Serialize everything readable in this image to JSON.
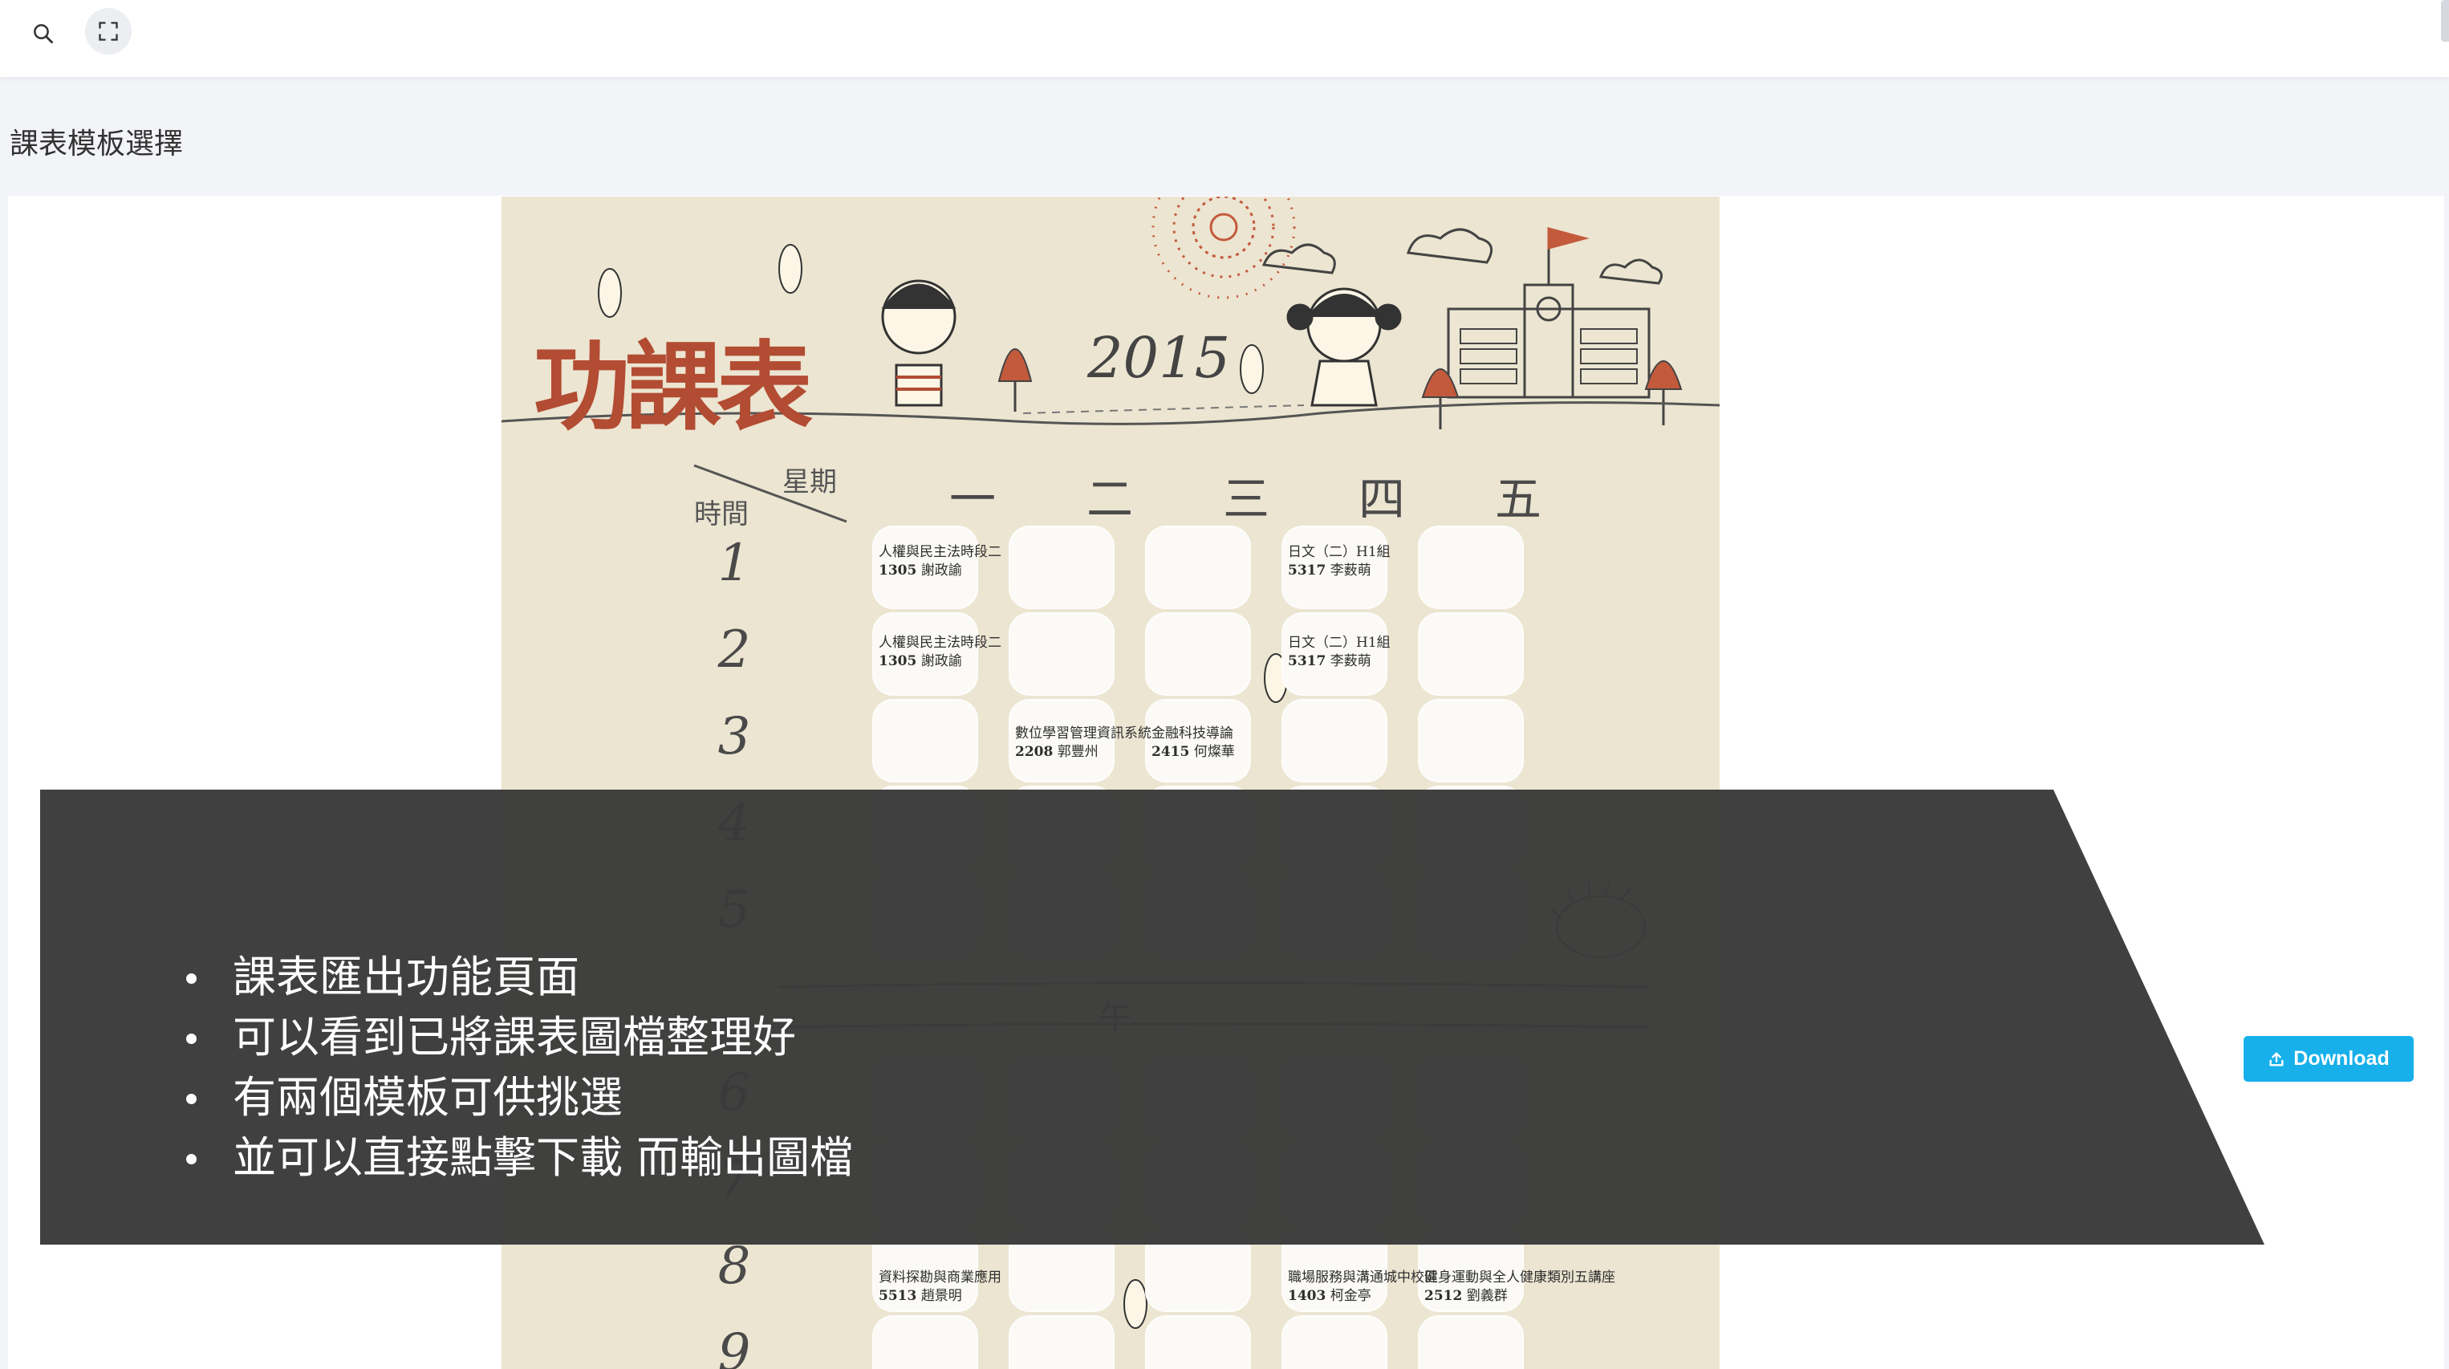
{
  "header": {
    "search_icon": "search-icon",
    "fullscreen_icon": "fullscreen-icon"
  },
  "page": {
    "title": "課表模板選擇"
  },
  "template": {
    "poster_title": "功課表",
    "year": "2015",
    "corner_week": "星期",
    "corner_time": "時間",
    "days": [
      "一",
      "二",
      "三",
      "四",
      "五"
    ],
    "periods": [
      "1",
      "2",
      "3",
      "4",
      "5",
      "6",
      "7",
      "8",
      "9"
    ],
    "lunch_label": "午",
    "entries": [
      {
        "course": "人權與民主法時段二",
        "code": "1305",
        "teacher": "謝政諭"
      },
      {
        "course": "日文（二）H1組",
        "code": "5317",
        "teacher": "李薮萌"
      },
      {
        "course": "人權與民主法時段二",
        "code": "1305",
        "teacher": "謝政諭"
      },
      {
        "course": "日文（二）H1組",
        "code": "5317",
        "teacher": "李薮萌"
      },
      {
        "course": "數位學習管理資訊系統",
        "code": "2208",
        "teacher": "郭豐州"
      },
      {
        "course": "金融科技導論",
        "code": "2415",
        "teacher": "何燦華"
      },
      {
        "course": "資料探勘與商業應用",
        "code": "5513",
        "teacher": "趙景明"
      },
      {
        "course": "職場服務與溝通城中校區",
        "code": "1403",
        "teacher": "柯金亭"
      },
      {
        "course": "健身運動與全人健康類別五講座",
        "code": "2512",
        "teacher": "劉義群"
      }
    ]
  },
  "overlay": {
    "bullets": [
      "課表匯出功能頁面",
      "可以看到已將課表圖檔整理好",
      "有兩個模板可供挑選",
      "並可以直接點擊下載 而輸出圖檔"
    ]
  },
  "actions": {
    "download_label": "Download",
    "download_icon": "upload-icon"
  },
  "colors": {
    "header_bg": "#ffffff",
    "page_bg": "#f3f4f8",
    "poster_bg": "#ece5d1",
    "poster_title": "#b24c33",
    "overlay_bg": "#3c3c3c",
    "download_button": "#17b0ea"
  }
}
